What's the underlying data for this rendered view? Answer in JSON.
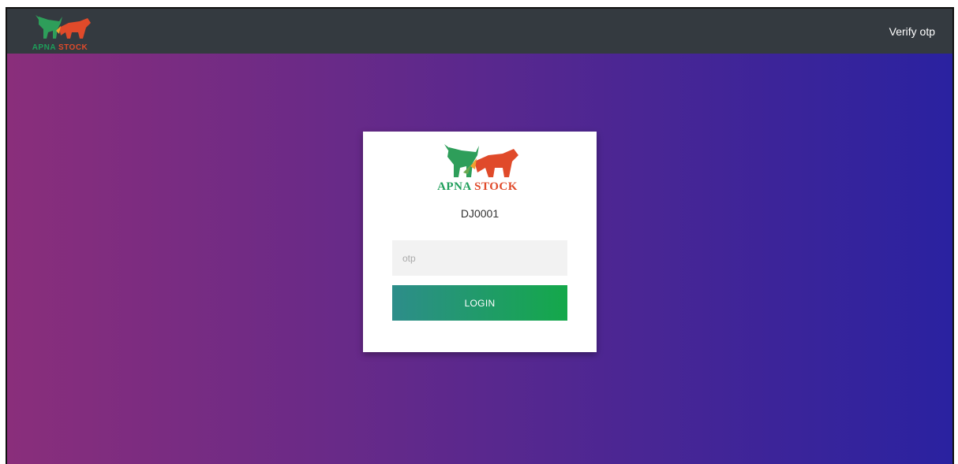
{
  "brand": {
    "name_part1": "APNA",
    "name_part2": "STOCK",
    "color_green": "#1e9e5a",
    "color_red": "#e04a2a"
  },
  "navbar": {
    "right_link": "Verify otp",
    "background": "#343a40"
  },
  "background": {
    "gradient_start": "#8a2e7b",
    "gradient_end": "#2a22a0"
  },
  "card": {
    "user_id": "DJ0001",
    "otp_placeholder": "otp",
    "otp_value": "",
    "login_label": "LOGIN",
    "login_gradient_start": "#2d8d8a",
    "login_gradient_end": "#14a84a"
  }
}
